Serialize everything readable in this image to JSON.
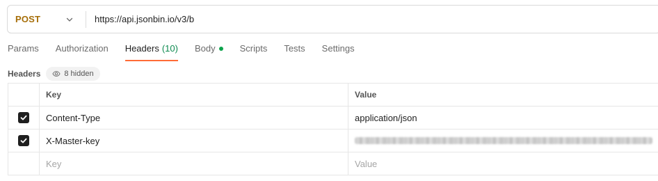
{
  "request": {
    "method": "POST",
    "url": "https://api.jsonbin.io/v3/b"
  },
  "tabs": [
    {
      "label": "Params"
    },
    {
      "label": "Authorization"
    },
    {
      "label": "Headers",
      "count": "(10)",
      "active": true
    },
    {
      "label": "Body",
      "indicator": "green-dot"
    },
    {
      "label": "Scripts"
    },
    {
      "label": "Tests"
    },
    {
      "label": "Settings"
    }
  ],
  "headers_section": {
    "title": "Headers",
    "hidden_label": "8 hidden",
    "hidden_icon": "eye-icon"
  },
  "table": {
    "columns": {
      "key": "Key",
      "value": "Value"
    },
    "rows": [
      {
        "checked": true,
        "key": "Content-Type",
        "value": "application/json"
      },
      {
        "checked": true,
        "key": "X-Master-key",
        "value_redacted": true
      }
    ],
    "placeholder": {
      "key": "Key",
      "value": "Value"
    }
  },
  "colors": {
    "method": "#a66e08",
    "active_tab_underline": "#ff6c37",
    "count": "#0c8a4f",
    "body_dot": "#0ca34b"
  }
}
